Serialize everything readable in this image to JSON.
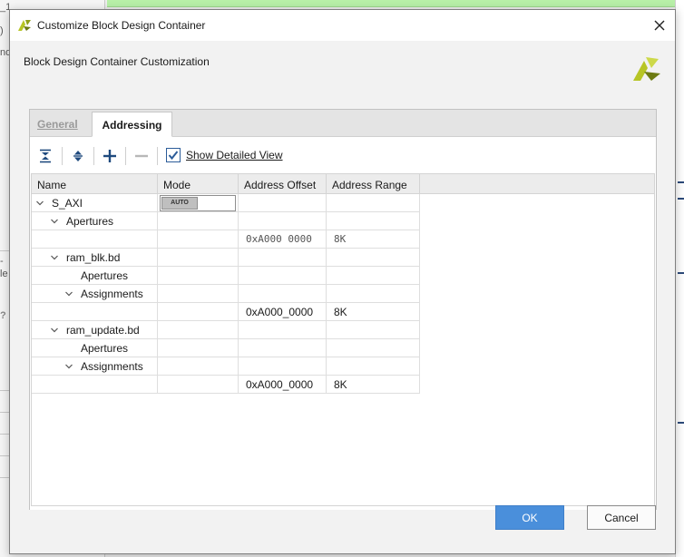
{
  "dialog": {
    "title": "Customize Block Design Container",
    "subtitle": "Block Design Container Customization"
  },
  "tabs": [
    {
      "label": "General",
      "active": false
    },
    {
      "label": "Addressing",
      "active": true
    }
  ],
  "toolbar": {
    "collapse_all_icon": "collapse-all-icon",
    "expand_all_icon": "expand-all-icon",
    "add_icon": "plus-icon",
    "remove_icon": "minus-icon",
    "show_detailed_view": {
      "label": "Show Detailed View",
      "checked": true
    }
  },
  "table": {
    "columns": [
      "Name",
      "Mode",
      "Address Offset",
      "Address Range"
    ],
    "rows": [
      {
        "name": "S_AXI",
        "mode": "AUTO",
        "offset": "",
        "range": ""
      },
      {
        "name": "Apertures",
        "mode": "",
        "offset": "",
        "range": ""
      },
      {
        "name": "",
        "mode": "",
        "offset": "0xA000 0000",
        "range": "8K"
      },
      {
        "name": "ram_blk.bd",
        "mode": "",
        "offset": "",
        "range": ""
      },
      {
        "name": "Apertures",
        "mode": "",
        "offset": "",
        "range": ""
      },
      {
        "name": "Assignments",
        "mode": "",
        "offset": "",
        "range": ""
      },
      {
        "name": "",
        "mode": "",
        "offset": "0xA000_0000",
        "range": "8K"
      },
      {
        "name": "ram_update.bd",
        "mode": "",
        "offset": "",
        "range": ""
      },
      {
        "name": "Apertures",
        "mode": "",
        "offset": "",
        "range": ""
      },
      {
        "name": "Assignments",
        "mode": "",
        "offset": "",
        "range": ""
      },
      {
        "name": "",
        "mode": "",
        "offset": "0xA000_0000",
        "range": "8K"
      }
    ]
  },
  "buttons": {
    "ok": "OK",
    "cancel": "Cancel"
  },
  "colors": {
    "accent": "#4a8fdb",
    "brand_yellow": "#b7c525",
    "brand_dark": "#6c7a12"
  },
  "background": {
    "fragments": [
      "_1",
      ")",
      "nd",
      "-",
      "le",
      "?"
    ]
  }
}
